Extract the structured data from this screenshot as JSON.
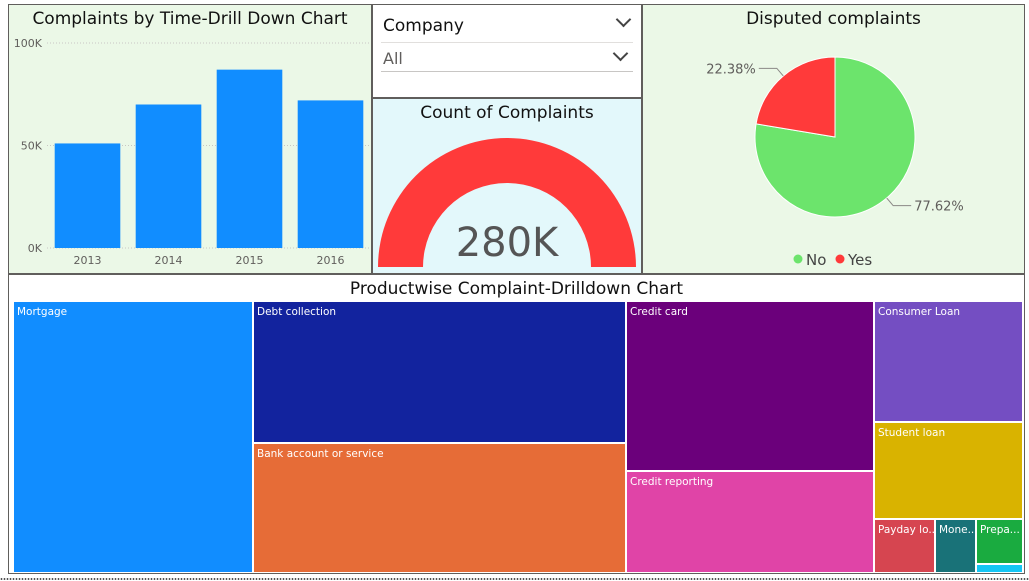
{
  "bar_panel": {
    "title": "Complaints by Time-Drill Down Chart"
  },
  "slicer": {
    "label": "Company",
    "value": "All"
  },
  "gauge_panel": {
    "title": "Count of Complaints",
    "value": "280K",
    "color": "#ff3a3a"
  },
  "pie_panel": {
    "title": "Disputed complaints",
    "legend": [
      {
        "label": "No",
        "color": "#6ce46c"
      },
      {
        "label": "Yes",
        "color": "#ff3a3a"
      }
    ]
  },
  "treemap_panel": {
    "title": "Productwise Complaint-Drilldown Chart"
  },
  "chart_data": [
    {
      "type": "bar",
      "title": "Complaints by Time-Drill Down Chart",
      "categories": [
        "2013",
        "2014",
        "2015",
        "2016"
      ],
      "values": [
        51000,
        70000,
        87000,
        72000
      ],
      "ylim": [
        0,
        100000
      ],
      "ytick_labels": [
        "0K",
        "50K",
        "100K"
      ],
      "ytick_values": [
        0,
        50000,
        100000
      ],
      "color": "#118dff",
      "grid": true
    },
    {
      "type": "pie",
      "title": "Disputed complaints",
      "slices": [
        {
          "name": "No",
          "value": 77.62,
          "label": "77.62%",
          "color": "#6ce46c"
        },
        {
          "name": "Yes",
          "value": 22.38,
          "label": "22.38%",
          "color": "#ff3a3a"
        }
      ],
      "legend_position": "bottom"
    },
    {
      "type": "treemap",
      "title": "Productwise Complaint-Drilldown Chart",
      "items": [
        {
          "label": "Mortgage",
          "color": "#118dff"
        },
        {
          "label": "Debt collection",
          "color": "#12239e"
        },
        {
          "label": "Bank account or service",
          "color": "#e66c37"
        },
        {
          "label": "Credit card",
          "color": "#6b007b"
        },
        {
          "label": "Credit reporting",
          "color": "#e044a7"
        },
        {
          "label": "Consumer Loan",
          "color": "#744ec2"
        },
        {
          "label": "Student loan",
          "color": "#d9b300"
        },
        {
          "label": "Payday lo...",
          "color": "#d64550"
        },
        {
          "label": "Mone...",
          "color": "#197278"
        },
        {
          "label": "Prepa...",
          "color": "#1aab40"
        },
        {
          "label": "",
          "color": "#15c6f4"
        }
      ]
    }
  ]
}
